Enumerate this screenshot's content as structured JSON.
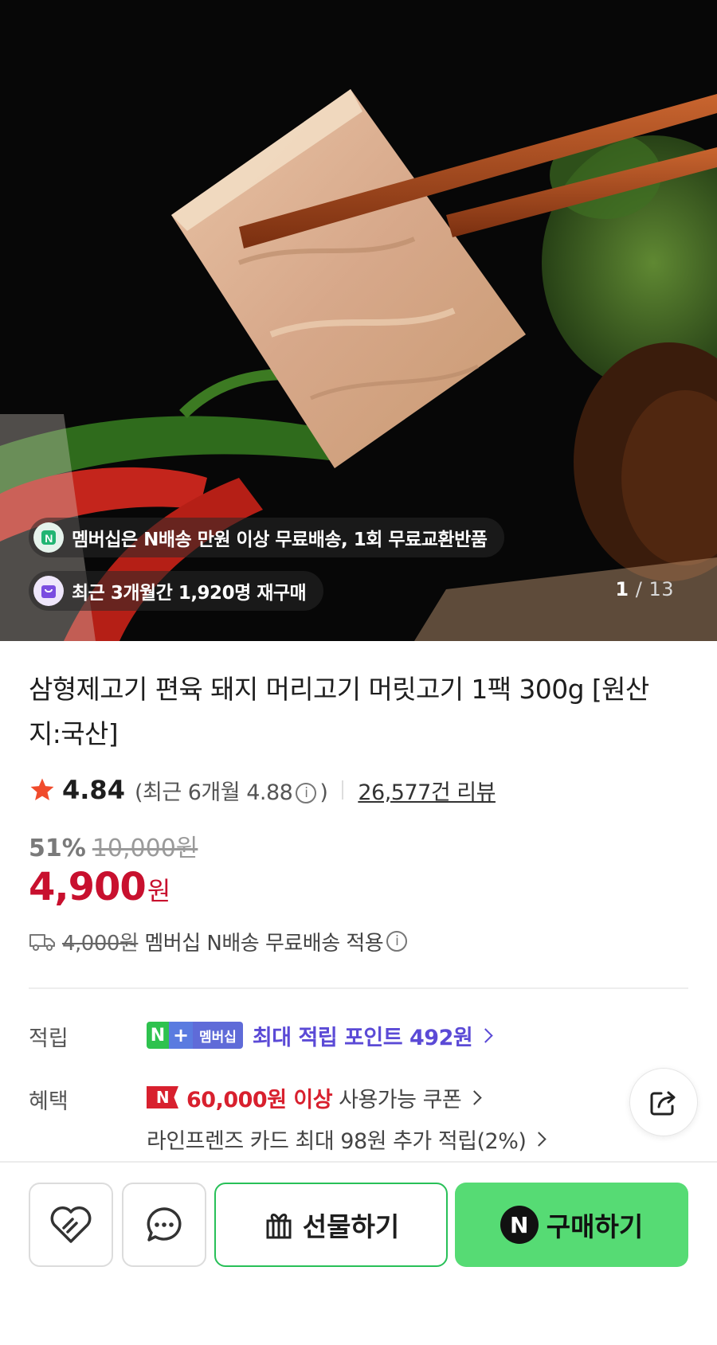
{
  "hero": {
    "membership_text": "멤버십은 N배송 만원 이상 무료배송, 1회 무료교환반품",
    "repurchase_text": "최근 3개월간 1,920명 재구매",
    "page_current": "1",
    "page_separator": "/",
    "page_total": "13"
  },
  "product": {
    "title": "삼형제고기 편육 돼지 머리고기 머릿고기 1팩 300g [원산지:국산]",
    "rating": "4.84",
    "recent_rating_prefix": "(최근 6개월 4.88",
    "recent_rating_suffix": ")",
    "review_count": "26,577건 리뷰",
    "discount_percent": "51%",
    "original_price": "10,000원",
    "price": "4,900",
    "price_unit": "원",
    "shipping_original": "4,000원",
    "shipping_text": "멤버십 N배송 무료배송 적용"
  },
  "benefits": {
    "points_label": "적립",
    "points_badge_n": "N",
    "points_badge_plus": "+",
    "points_badge_text": "멤버십",
    "points_text": "최대 적립 포인트 492원",
    "benefit_label": "혜택",
    "coupon_badge": "N",
    "coupon_amount": "60,000원 이상",
    "coupon_text": "사용가능 쿠폰",
    "card_text": "라인프렌즈 카드 최대 98원 추가 적립(2%)"
  },
  "actions": {
    "gift_label": "선물하기",
    "buy_label": "구매하기",
    "buy_badge": "N"
  },
  "icons": {
    "star": "star-icon",
    "info": "info-icon",
    "truck": "truck-icon",
    "share": "share-icon",
    "wishlist": "heart-icon",
    "talk": "chat-bubble-icon",
    "gift": "gift-icon"
  },
  "colors": {
    "price_red": "#c8102e",
    "points_purple": "#5b4ad6",
    "buy_green": "#56db74",
    "gift_border": "#28c058",
    "star_red": "#f04b2c"
  }
}
